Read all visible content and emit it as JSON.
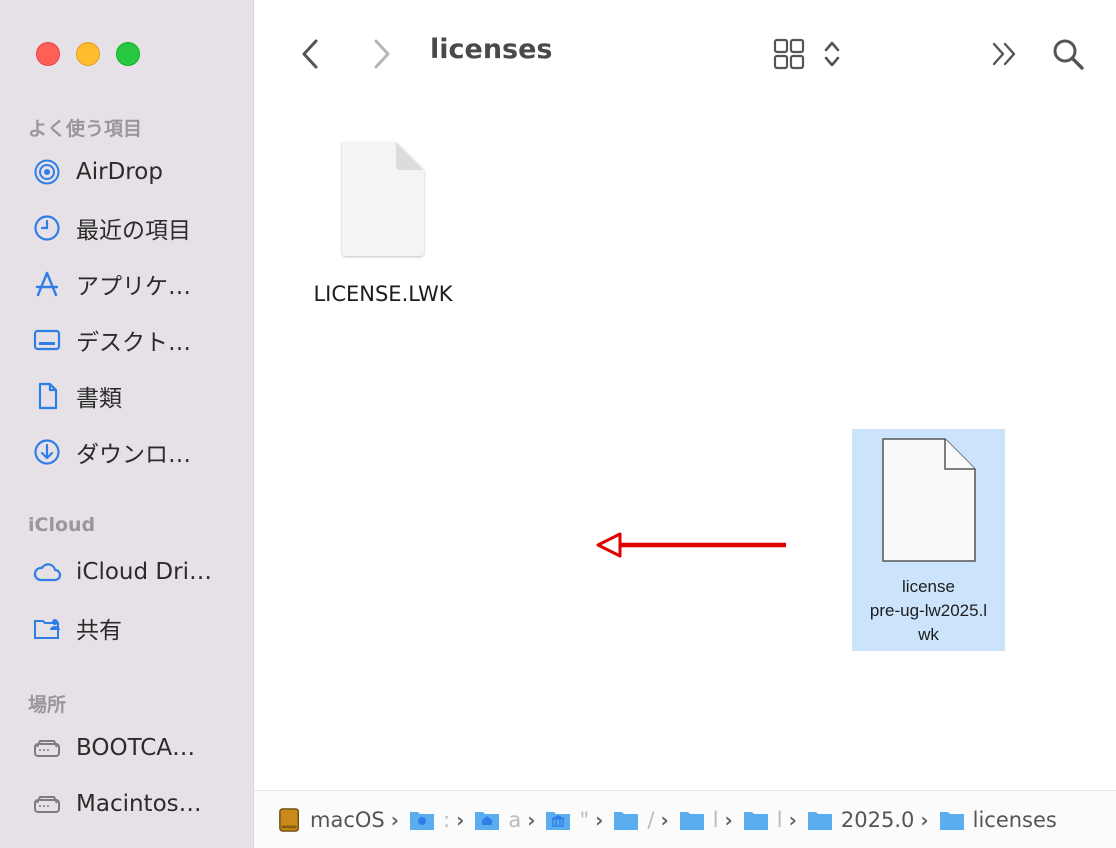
{
  "toolbar": {
    "title": "licenses",
    "back_icon": "chevron-left-icon",
    "forward_icon": "chevron-right-icon",
    "view_icon": "grid-view-icon",
    "sort_icon": "up-down-chevron-icon",
    "more_icon": "double-chevron-icon",
    "search_icon": "search-icon"
  },
  "sidebar": {
    "favorites_title": "よく使う項目",
    "favorites": [
      {
        "label": "AirDrop",
        "icon": "airdrop-icon"
      },
      {
        "label": "最近の項目",
        "icon": "clock-icon"
      },
      {
        "label": "アプリケ…",
        "icon": "applications-icon"
      },
      {
        "label": "デスクト…",
        "icon": "desktop-icon"
      },
      {
        "label": "書類",
        "icon": "document-icon"
      },
      {
        "label": "ダウンロ…",
        "icon": "download-icon"
      }
    ],
    "icloud_title": "iCloud",
    "icloud": [
      {
        "label": "iCloud Dri…",
        "icon": "cloud-icon"
      },
      {
        "label": "共有",
        "icon": "shared-folder-icon"
      }
    ],
    "locations_title": "場所",
    "locations": [
      {
        "label": "BOOTCA…",
        "icon": "disk-icon"
      },
      {
        "label": "Macintos…",
        "icon": "disk-icon"
      }
    ]
  },
  "files": [
    {
      "name": "LICENSE.LWK",
      "selected": false
    },
    {
      "name_line1": "license",
      "name_line2": "pre-ug-lw2025.l",
      "name_line3": "wk",
      "selected": true
    }
  ],
  "pathbar": [
    {
      "label": "macOS",
      "icon": "drive-icon"
    },
    {
      "label": ":",
      "icon": "user-folder-icon"
    },
    {
      "label": "a",
      "icon": "home-folder-icon"
    },
    {
      "label": "\"",
      "icon": "library-folder-icon"
    },
    {
      "label": "/",
      "icon": "folder-icon"
    },
    {
      "label": "l",
      "icon": "folder-icon"
    },
    {
      "label": "l",
      "icon": "folder-icon"
    },
    {
      "label": "2025.0",
      "icon": "folder-icon"
    },
    {
      "label": "licenses",
      "icon": "folder-icon"
    }
  ],
  "colors": {
    "accent": "#2f7ee8",
    "selection": "#cce4fb",
    "arrow": "#e00000"
  }
}
